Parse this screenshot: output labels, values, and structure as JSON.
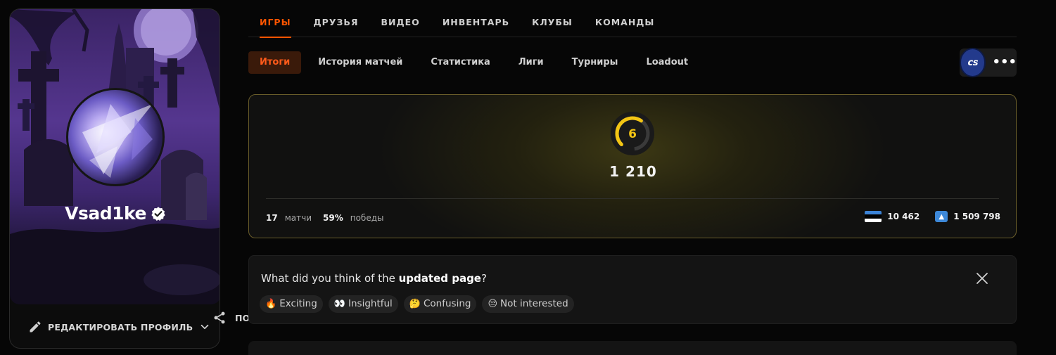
{
  "profile": {
    "username": "Vsad1ke",
    "edit_label": "РЕДАКТИРОВАТЬ ПРОФИЛЬ",
    "share_label": "ПОДЕЛИТЬСЯ"
  },
  "top_tabs": [
    {
      "label": "ИГРЫ",
      "active": true
    },
    {
      "label": "ДРУЗЬЯ"
    },
    {
      "label": "ВИДЕО"
    },
    {
      "label": "ИНВЕНТАРЬ"
    },
    {
      "label": "КЛУБЫ"
    },
    {
      "label": "КОМАНДЫ"
    }
  ],
  "sub_tabs": [
    {
      "label": "Итоги",
      "active": true
    },
    {
      "label": "История матчей"
    },
    {
      "label": "Статистика"
    },
    {
      "label": "Лиги"
    },
    {
      "label": "Турниры"
    },
    {
      "label": "Loadout"
    }
  ],
  "game": {
    "logo_text": "cs",
    "more_label": "•••"
  },
  "stats": {
    "level": "6",
    "level_fraction": 0.55,
    "elo": "1 210",
    "matches_value": "17",
    "matches_label": "матчи",
    "winrate_value": "59%",
    "winrate_label": "победы",
    "country_rank": "10 462",
    "region_rank": "1 509 798"
  },
  "feedback": {
    "question_prefix": "What did you think of the ",
    "question_bold": "updated page",
    "question_suffix": "?",
    "options": [
      {
        "emoji": "🔥",
        "label": "Exciting"
      },
      {
        "emoji": "👀",
        "label": "Insightful"
      },
      {
        "emoji": "🤔",
        "label": "Confusing"
      },
      {
        "emoji": "😒",
        "label": "Not interested"
      }
    ]
  },
  "colors": {
    "accent": "#ff5500",
    "level_yellow": "#f3c514",
    "card_border": "#6a5d2a",
    "flag": [
      "#3b83d6",
      "#000000",
      "#ffffff"
    ]
  }
}
